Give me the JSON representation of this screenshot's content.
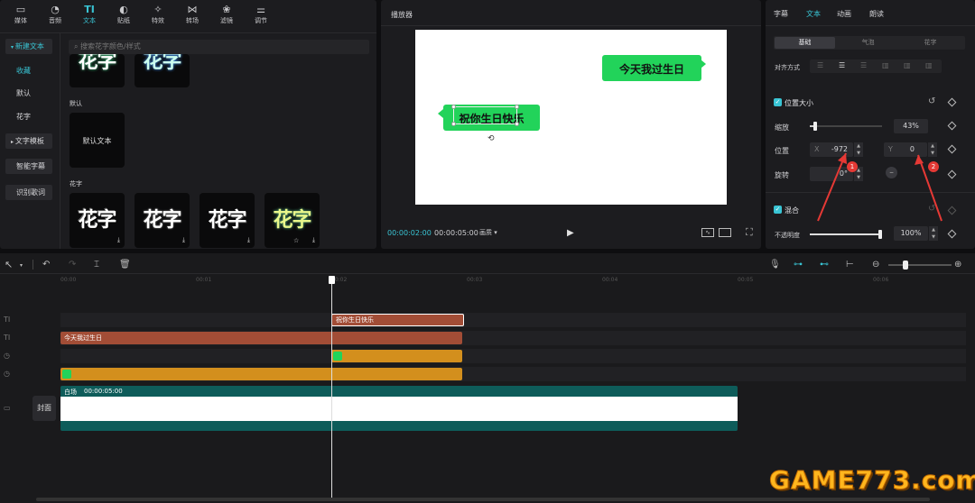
{
  "toolbar": {
    "tabs": [
      {
        "icon": "▭",
        "label": "媒体"
      },
      {
        "icon": "◔",
        "label": "音频"
      },
      {
        "icon": "TI",
        "label": "文本"
      },
      {
        "icon": "◐",
        "label": "贴纸"
      },
      {
        "icon": "✧",
        "label": "特效"
      },
      {
        "icon": "⋈",
        "label": "转场"
      },
      {
        "icon": "❀",
        "label": "滤镜"
      },
      {
        "icon": "⚌",
        "label": "调节"
      }
    ],
    "active_tab": "文本"
  },
  "left_sidebar": {
    "items": [
      "新建文本",
      "收藏",
      "默认",
      "花字",
      "文字模板",
      "智能字幕",
      "识别歌词"
    ]
  },
  "text_library": {
    "search_placeholder": "搜索花字颜色/样式",
    "section_default": "默认",
    "default_tile_label": "默认文本",
    "section_huazi": "花字",
    "huazi_text": "花字"
  },
  "player": {
    "title": "播放器",
    "bubble_top": "今天我过生日",
    "bubble_bottom": "祝你生日快乐",
    "current_time": "00:00:02:00",
    "total_time": "00:00:05:00",
    "quality": "画质",
    "quality_arrow": "▾",
    "play_icon": "▶"
  },
  "inspector": {
    "tabs": [
      "字幕",
      "文本",
      "动画",
      "朗读"
    ],
    "active_tab": "文本",
    "subtabs": [
      "基础",
      "气泡",
      "花字"
    ],
    "align_label": "对齐方式",
    "position_size": "位置大小",
    "scale_label": "缩放",
    "scale_value": "43%",
    "scale_fraction": 0.43,
    "position_label": "位置",
    "x_label": "X",
    "x_value": "-972",
    "y_label": "Y",
    "y_value": "0",
    "rotate_label": "旋转",
    "rotate_value": "0°",
    "blend_label": "混合",
    "opacity_label": "不透明度",
    "opacity_value": "100%",
    "opacity_fraction": 1.0,
    "marker1": "1",
    "marker2": "2",
    "reset_icon": "↺"
  },
  "timeline": {
    "ruler": [
      "00:00",
      "00:01",
      "00:02",
      "00:03",
      "00:04",
      "00:05",
      "00:06"
    ],
    "clips": {
      "text1": "祝你生日快乐",
      "text2": "今天我过生日",
      "video_name": "白场",
      "video_duration": "00:00:05:00",
      "cover": "封面"
    },
    "track_icons": [
      "TI",
      "TI",
      "◷",
      "◷",
      "▭"
    ]
  },
  "colors": {
    "accent": "#39c4d4",
    "bubble_green": "#22d35a",
    "text_clip": "#a24d36",
    "audio_clip": "#d38f1d",
    "video_clip": "#0e5c5a",
    "annotation_red": "#e53935"
  },
  "watermark": "GAME773.com"
}
